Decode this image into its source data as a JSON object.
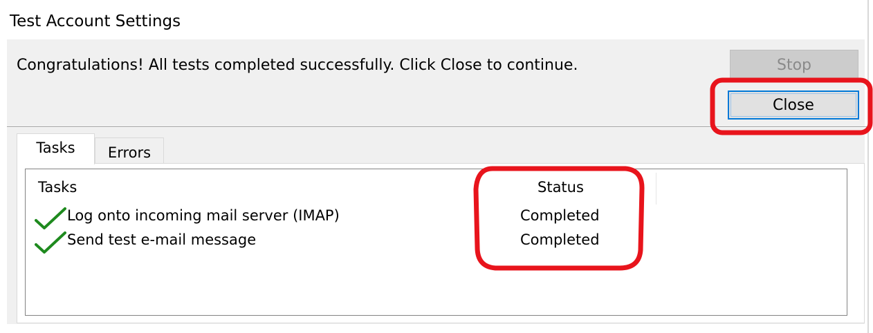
{
  "window": {
    "title": "Test Account Settings"
  },
  "message": "Congratulations! All tests completed successfully. Click Close to continue.",
  "buttons": {
    "stop_label": "Stop",
    "close_label": "Close"
  },
  "tabs": [
    {
      "label": "Tasks",
      "selected": true
    },
    {
      "label": "Errors",
      "selected": false
    }
  ],
  "list": {
    "columns": [
      "Tasks",
      "Status"
    ],
    "rows": [
      {
        "icon": "checkmark-icon",
        "task": "Log onto incoming mail server (IMAP)",
        "status": "Completed"
      },
      {
        "icon": "checkmark-icon",
        "task": "Send test e-mail message",
        "status": "Completed"
      }
    ]
  },
  "colors": {
    "accent": "#0078d7",
    "checkmark": "#1e8a1e",
    "annotation": "#e8141c",
    "dialog_background": "#f0f0f0"
  }
}
